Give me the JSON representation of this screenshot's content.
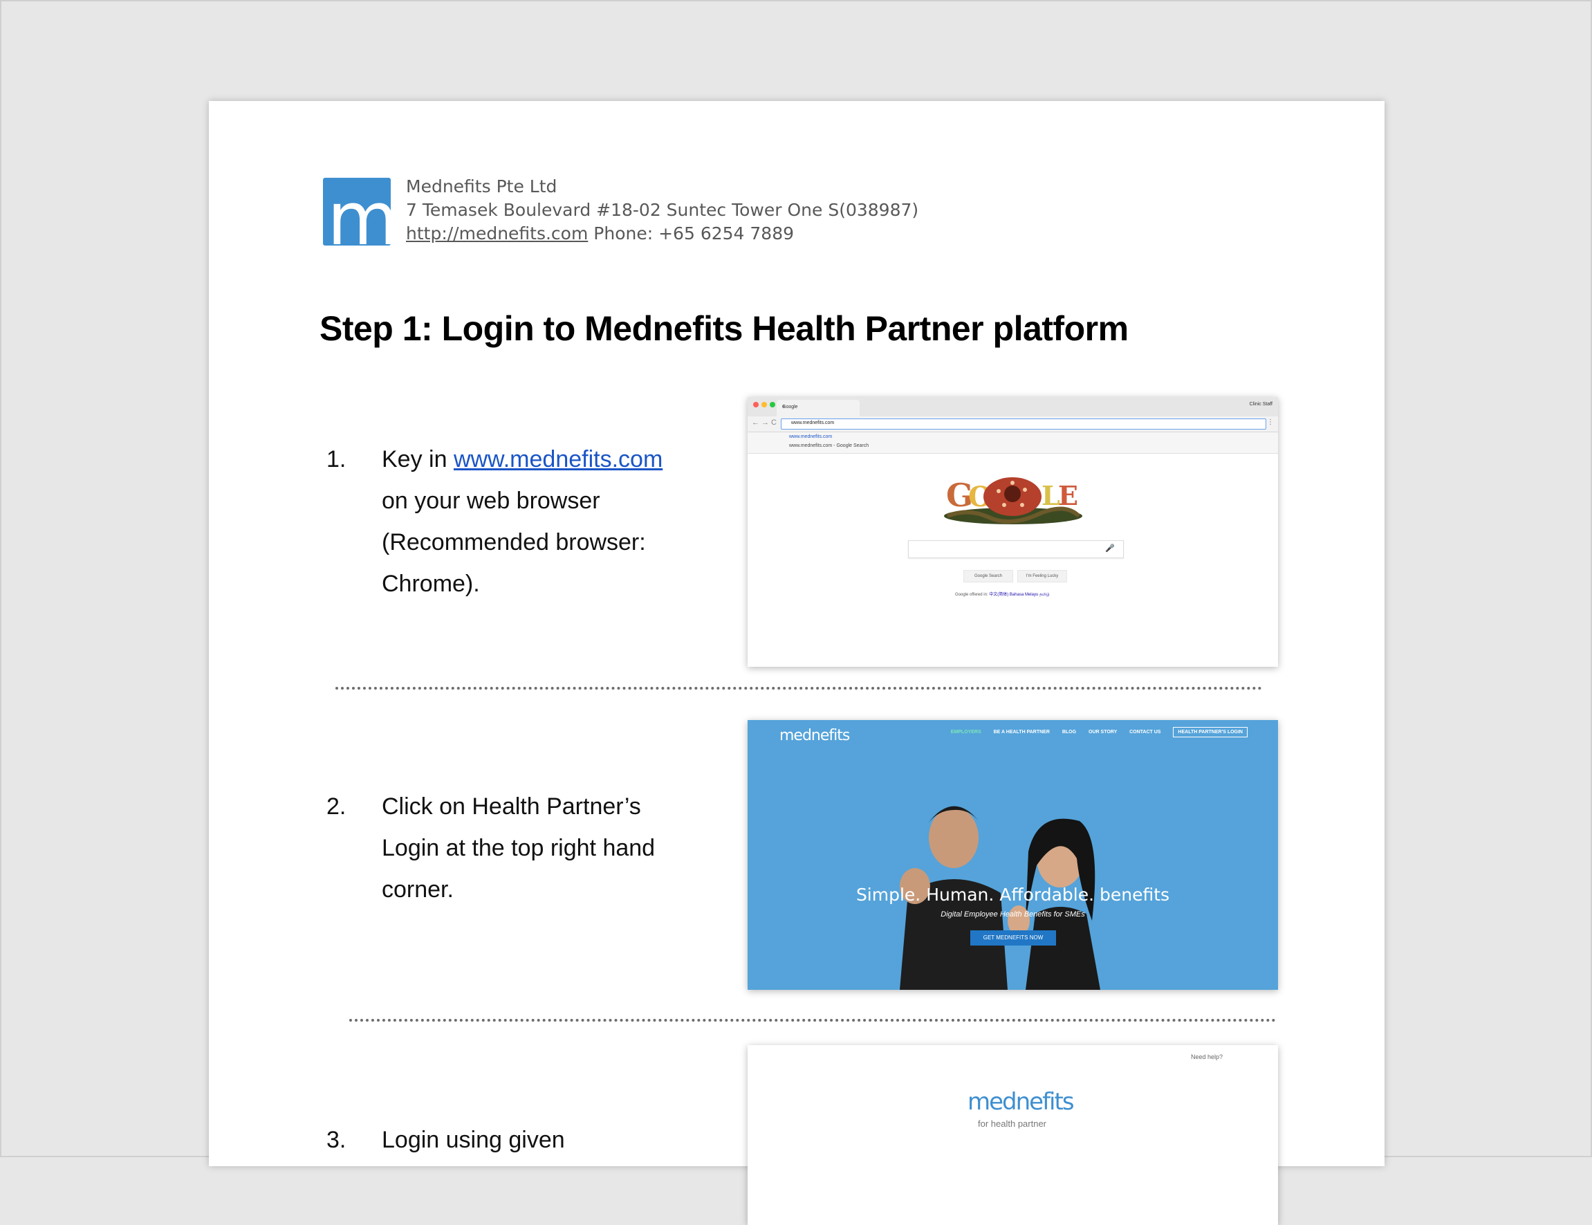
{
  "letterhead": {
    "logo_letter": "m",
    "company_name": "Mednefits Pte Ltd",
    "address": "7 Temasek Boulevard #18-02 Suntec Tower One S(038987)",
    "website": "http://mednefits.com",
    "phone": "Phone: +65 6254 7889"
  },
  "title": "Step 1: Login to Mednefits Health Partner platform",
  "steps": [
    {
      "number": "1.",
      "prefix": "Key in ",
      "link": "www.mednefits.com",
      "lines": [
        "on your web browser",
        "(Recommended browser:",
        "Chrome)."
      ]
    },
    {
      "number": "2.",
      "lines": [
        "Click on Health Partner’s",
        "Login at the top right hand",
        "corner."
      ]
    },
    {
      "number": "3.",
      "lines": [
        "Login using given"
      ]
    }
  ],
  "screenshot1": {
    "tab_title": "Google",
    "profile": "Clinic Staff",
    "url": "www.mednefits.com",
    "suggestion1": "www.mednefits.com",
    "suggestion2": "www.mednefits.com - Google Search",
    "button_search": "Google Search",
    "button_lucky": "I'm Feeling Lucky",
    "offered_prefix": "Google offered in:",
    "offered_langs": "中文(简体)  Bahasa Melayu  தமிழ்",
    "doodle_letters": "GOOGLE"
  },
  "screenshot2": {
    "logo": "mednefits",
    "nav": [
      "EMPLOYERS",
      "BE A HEALTH PARTNER",
      "BLOG",
      "OUR STORY",
      "CONTACT US",
      "HEALTH PARTNER'S LOGIN"
    ],
    "hero_title": "Simple. Human. Affordable. benefits",
    "hero_subtitle": "Digital Employee Health Benefits for SMEs",
    "cta": "GET MEDNEFITS NOW"
  },
  "screenshot3": {
    "need_help": "Need help?",
    "logo": "mednefits",
    "subtitle": "for health partner"
  },
  "colors": {
    "brand_blue": "#3e8fd0",
    "hero_blue": "#55a3da",
    "link_blue": "#1a55c6"
  }
}
